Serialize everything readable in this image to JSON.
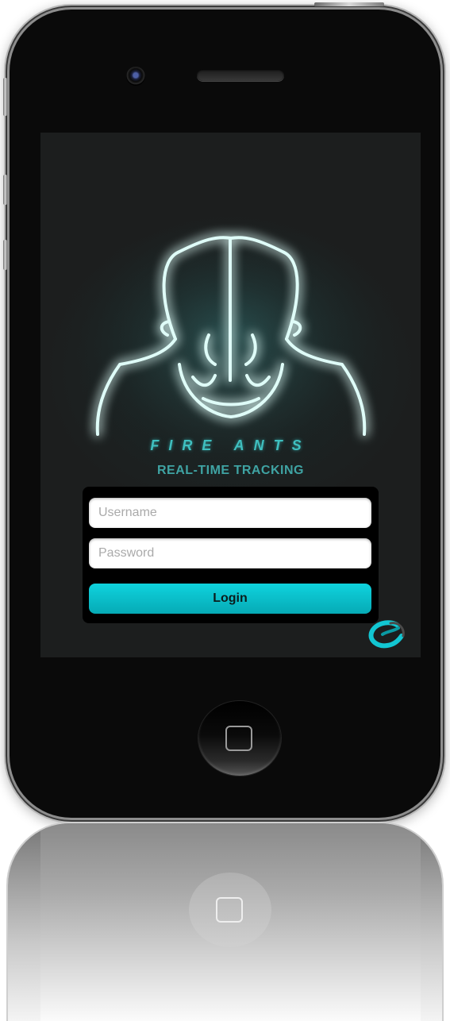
{
  "app": {
    "brand_name": "FIRE ANTS",
    "tagline": "REAL-TIME TRACKING"
  },
  "login_form": {
    "username_placeholder": "Username",
    "password_placeholder": "Password",
    "login_label": "Login"
  },
  "colors": {
    "accent": "#0fd3de",
    "glow": "#7ff5ef",
    "screen_bg": "#1c2222"
  },
  "icons": {
    "brand_logo": "fire-ant-head-icon",
    "corner_logo": "company-swirl-icon",
    "home_button": "home-square-icon"
  }
}
